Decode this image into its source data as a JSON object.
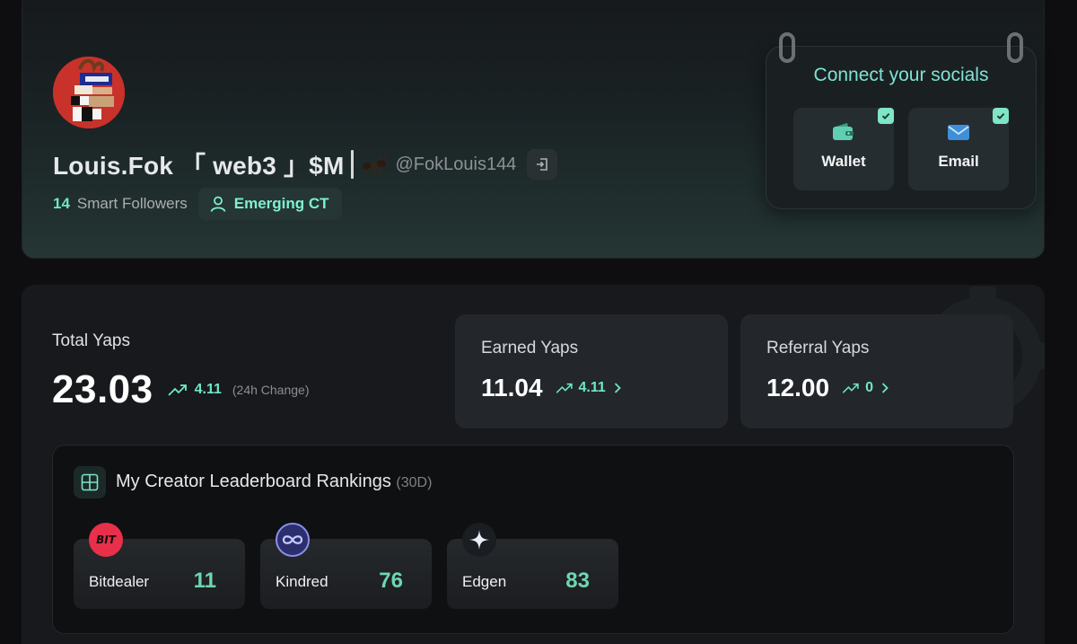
{
  "profile": {
    "display_name": "Louis.Fok 「 web3 」$M",
    "handle": "@FokLouis144",
    "smart_followers_count": "14",
    "smart_followers_label": "Smart Followers",
    "tier_badge": "Emerging CT"
  },
  "connect": {
    "title": "Connect your socials",
    "socials": [
      {
        "label": "Wallet",
        "icon": "wallet-icon",
        "connected": true
      },
      {
        "label": "Email",
        "icon": "mail-icon",
        "connected": true
      }
    ]
  },
  "yaps": {
    "total_label": "Total Yaps",
    "total_value": "23.03",
    "total_change": "4.11",
    "total_change_note": "(24h Change)",
    "earned_label": "Earned Yaps",
    "earned_value": "11.04",
    "earned_change": "4.11",
    "referral_label": "Referral Yaps",
    "referral_value": "12.00",
    "referral_change": "0"
  },
  "leaderboard": {
    "title": "My Creator Leaderboard Rankings",
    "period": "(30D)",
    "rankings": [
      {
        "name": "Bitdealer",
        "rank": "11",
        "logo_text": "BIT"
      },
      {
        "name": "Kindred",
        "rank": "76",
        "logo_text": ""
      },
      {
        "name": "Edgen",
        "rank": "83",
        "logo_text": ""
      }
    ]
  },
  "colors": {
    "accent": "#6ee7c8",
    "background": "#0e0e11",
    "card": "#17191c"
  }
}
